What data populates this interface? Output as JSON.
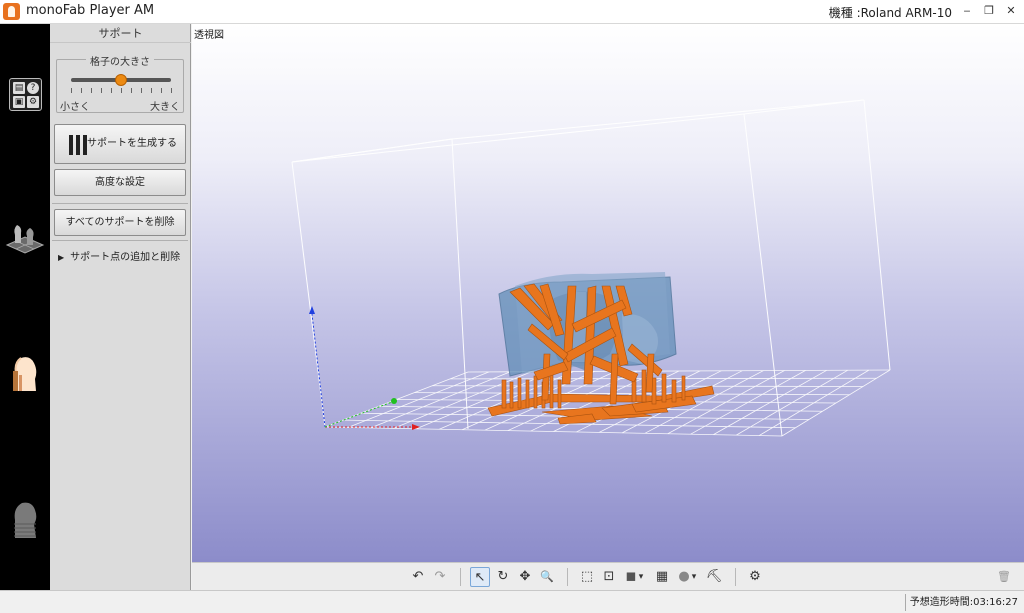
{
  "window": {
    "title": "monoFab Player AM",
    "model_label": "機種 :Roland ARM-10",
    "minimize_glyph": "‒",
    "restore_glyph": "❐",
    "close_glyph": "✕"
  },
  "leftbar": {
    "tool_icons": [
      "file-icon",
      "help-icon",
      "save-icon",
      "settings-icon"
    ],
    "modes": [
      "layout-mode-icon",
      "support-mode-icon",
      "print-mode-icon"
    ],
    "active_mode": "support-mode-icon"
  },
  "panel": {
    "title": "サポート",
    "grid_size": {
      "legend": "格子の大きさ",
      "min_label": "小さく",
      "max_label": "大きく",
      "value_fraction": 0.5
    },
    "generate_button": "サポートを生成する",
    "advanced_button": "高度な設定",
    "delete_all_button": "すべてのサポートを削除",
    "expander_arrow": "▶",
    "expander_label": "サポート点の追加と削除"
  },
  "viewport": {
    "view_label": "透視図"
  },
  "toolbar": {
    "undo": "↶",
    "redo": "↷",
    "select": "↖",
    "rotate": "↻",
    "move": "✥",
    "zoom": "🔍",
    "fit": "⬚",
    "fit_selection": "⊡",
    "view_cube": "◼",
    "dropdown": "▾",
    "layers": "▦",
    "shading": "●",
    "shading_dropdown": "▾",
    "tools": "⛏",
    "settings": "⚙",
    "trash": "🗑"
  },
  "status": {
    "estimated_time": "予想造形時間:03:16:27"
  },
  "colors": {
    "support": "#e8751e",
    "model": "#5a88b0",
    "slider_thumb": "#ec8a12"
  }
}
